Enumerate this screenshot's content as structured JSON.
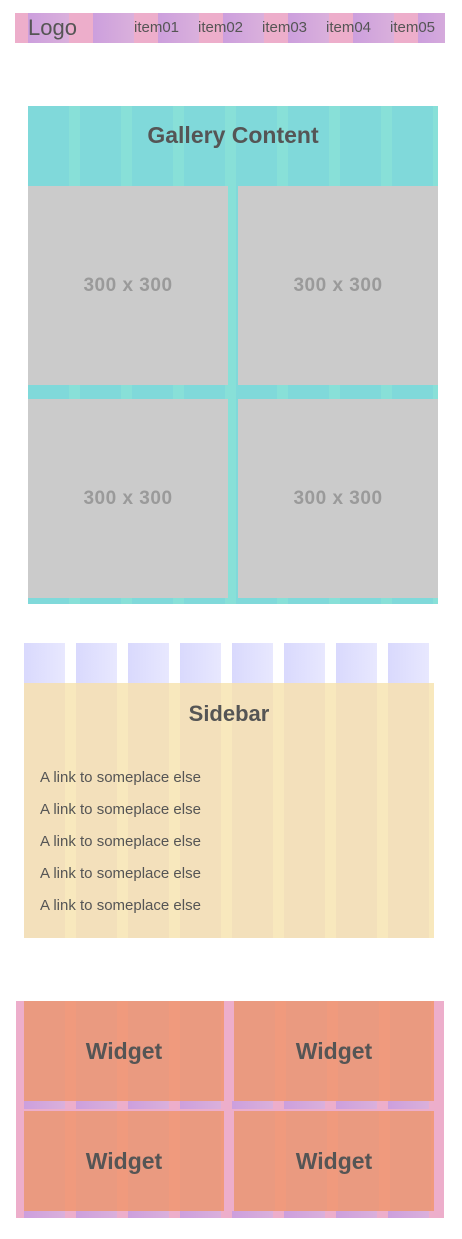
{
  "header": {
    "logo": "Logo",
    "nav": [
      "item01",
      "item02",
      "item03",
      "item04",
      "item05"
    ]
  },
  "gallery": {
    "title": "Gallery Content",
    "images": [
      "300 x 300",
      "300 x 300",
      "300 x 300",
      "300 x 300"
    ]
  },
  "sidebar": {
    "title": "Sidebar",
    "links": [
      "A link to someplace else",
      "A link to someplace else",
      "A link to someplace else",
      "A link to someplace else",
      "A link to someplace else"
    ]
  },
  "widgets": [
    "Widget",
    "Widget",
    "Widget",
    "Widget"
  ]
}
